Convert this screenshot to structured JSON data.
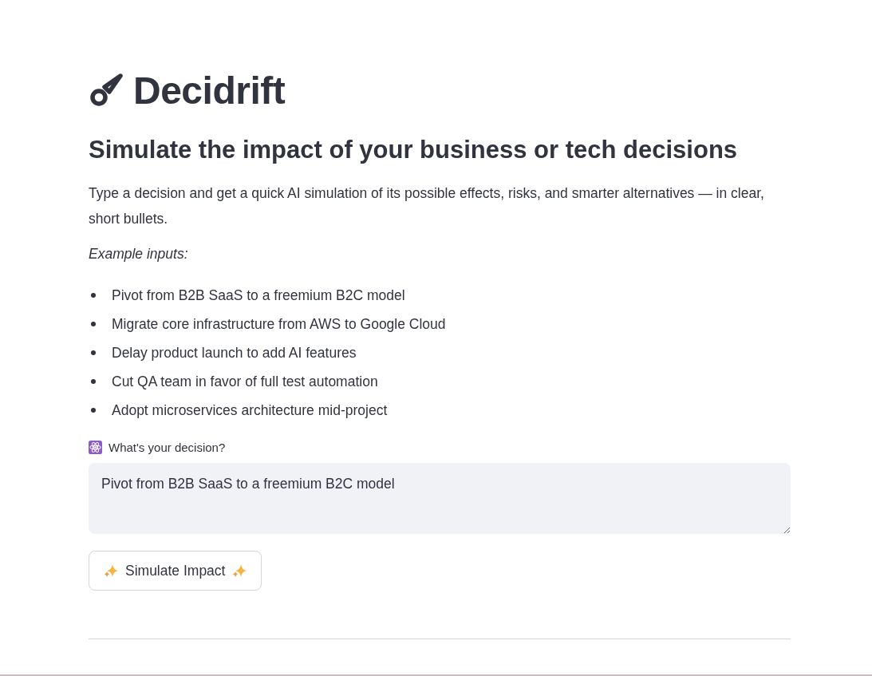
{
  "title": "Decidrift",
  "subtitle": "Simulate the impact of your business or tech decisions",
  "description": "Type a decision and get a quick AI simulation of its possible effects, risks, and smarter alternatives — in clear, short bullets.",
  "examples_label": "Example inputs:",
  "examples": [
    "Pivot from B2B SaaS to a freemium B2C model",
    "Migrate core infrastructure from AWS to Google Cloud",
    "Delay product launch to add AI features",
    "Cut QA team in favor of full test automation",
    "Adopt microservices architecture mid-project"
  ],
  "decision_field": {
    "label": "What's your decision?",
    "value": "Pivot from B2B SaaS to a freemium B2C model"
  },
  "simulate_button": {
    "label": "Simulate Impact"
  }
}
